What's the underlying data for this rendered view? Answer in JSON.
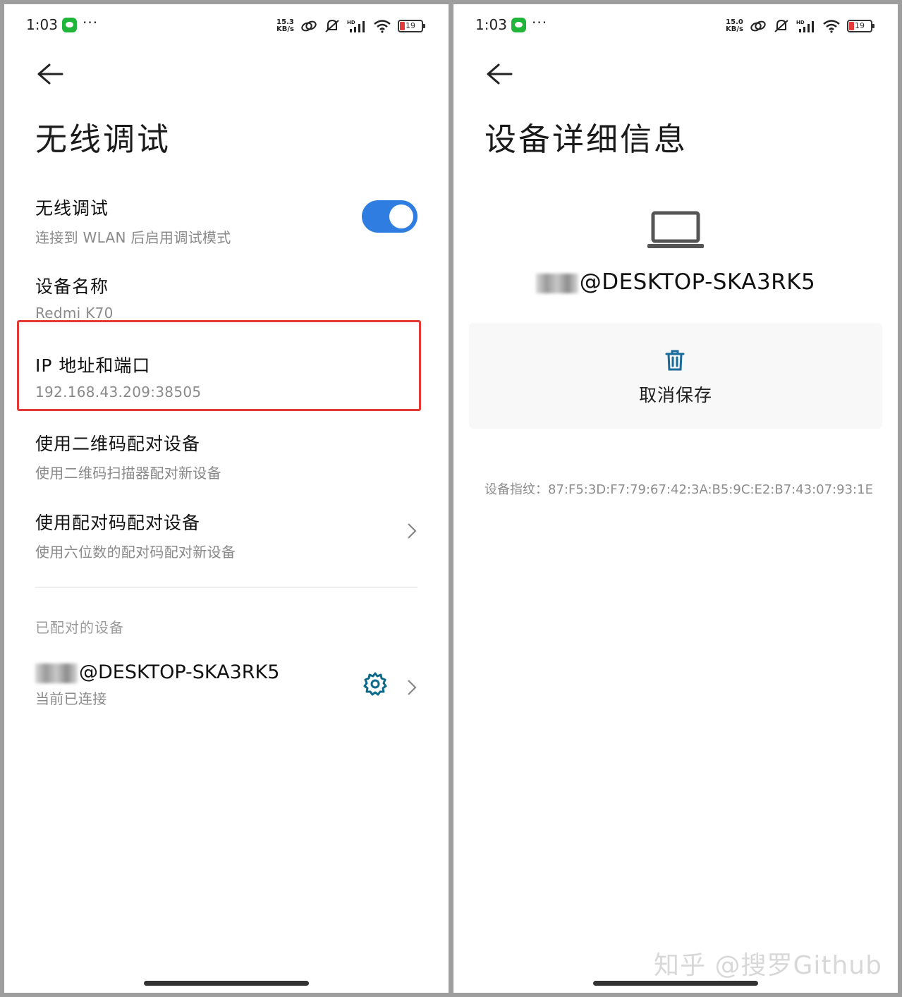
{
  "left": {
    "status": {
      "time": "1:03",
      "speed_top": "15.3",
      "speed_bottom": "KB/s",
      "battery": "19"
    },
    "title": "无线调试",
    "rows": {
      "wireless": {
        "title": "无线调试",
        "subtitle": "连接到 WLAN 后启用调试模式",
        "toggle_on": true
      },
      "device_name": {
        "title": "设备名称",
        "subtitle": "Redmi K70"
      },
      "ip": {
        "title": "IP 地址和端口",
        "subtitle": "192.168.43.209:38505"
      },
      "qr_pair": {
        "title": "使用二维码配对设备",
        "subtitle": "使用二维码扫描器配对新设备"
      },
      "code_pair": {
        "title": "使用配对码配对设备",
        "subtitle": "使用六位数的配对码配对新设备"
      }
    },
    "section_label": "已配对的设备",
    "paired_device": {
      "name": "@DESKTOP-SKA3RK5",
      "status": "当前已连接"
    }
  },
  "right": {
    "status": {
      "time": "1:03",
      "speed_top": "15.0",
      "speed_bottom": "KB/s",
      "battery": "19"
    },
    "title": "设备详细信息",
    "device_name": "@DESKTOP-SKA3RK5",
    "action_label": "取消保存",
    "fingerprint": "设备指纹：87:F5:3D:F7:79:67:42:3A:B5:9C:E2:B7:43:07:93:1E",
    "watermark": "知乎 @搜罗Github"
  },
  "colors": {
    "accent": "#2f7de1",
    "highlight": "#e53935",
    "gear": "#0e6a8a",
    "trash": "#1a6a9a"
  }
}
